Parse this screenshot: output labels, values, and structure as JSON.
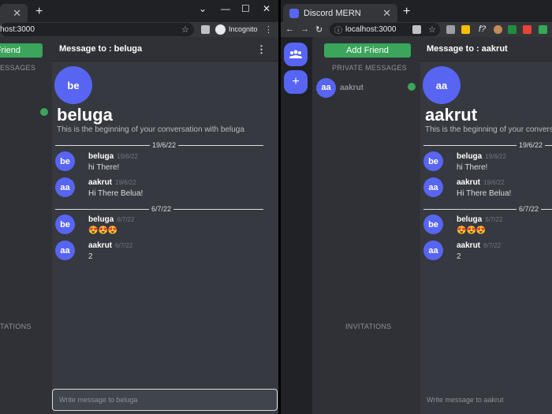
{
  "left": {
    "newtab": "+",
    "winctl": {
      "dropdown": "⌄",
      "min": "—",
      "max": "☐",
      "close": "✕"
    },
    "tab": {
      "close": "✕"
    },
    "address": "host:3000",
    "toolbar": {
      "incognito_label": "Incognito",
      "menu": "⋮",
      "bookmark": "☆"
    },
    "sidebar": {
      "add_friend": "Friend",
      "private_label": "ESSAGES",
      "invites_label": "TATIONS"
    },
    "chat": {
      "header": "Message to : beluga",
      "kebab": "⋮",
      "avatar_initials": "be",
      "big_name": "beluga",
      "beginning_text": "This is the beginning of your conversation with beluga",
      "composer_placeholder": "Write message to beluga"
    }
  },
  "right": {
    "tab": {
      "title": "Discord MERN",
      "close": "✕"
    },
    "newtab": "+",
    "address": "localhost:3000",
    "toolbar": {
      "back": "←",
      "fwd": "→",
      "reload": "↻",
      "info": "ⓘ",
      "bookmark": "☆",
      "fx": "f?"
    },
    "rail": {
      "friends_icon": "👥",
      "add": "+"
    },
    "sidebar": {
      "add_friend": "Add Friend",
      "private_label": "PRIVATE MESSAGES",
      "dm": {
        "initials": "aa",
        "name": "aakrut"
      },
      "invites_label": "INVITATIONS"
    },
    "chat": {
      "header": "Message to : aakrut",
      "avatar_initials": "aa",
      "big_name": "aakrut",
      "beginning_text": "This is the beginning of your conversation",
      "composer_placeholder": "Write message to aakrut"
    }
  },
  "messages": [
    {
      "date": "19/6/22"
    },
    {
      "initials": "be",
      "author": "beluga",
      "time": "19/6/22",
      "text": "hi There!"
    },
    {
      "initials": "aa",
      "author": "aakrut",
      "time": "19/6/22",
      "text": "Hi There Belua!"
    },
    {
      "date": "6/7/22"
    },
    {
      "initials": "be",
      "author": "beluga",
      "time": "6/7/22",
      "text": "😍😍😍"
    },
    {
      "initials": "aa",
      "author": "aakrut",
      "time": "6/7/22",
      "text": "2"
    }
  ],
  "colors": {
    "accent": "#5865f2",
    "online": "#3ba55c",
    "add_friend": "#3ba55c"
  }
}
